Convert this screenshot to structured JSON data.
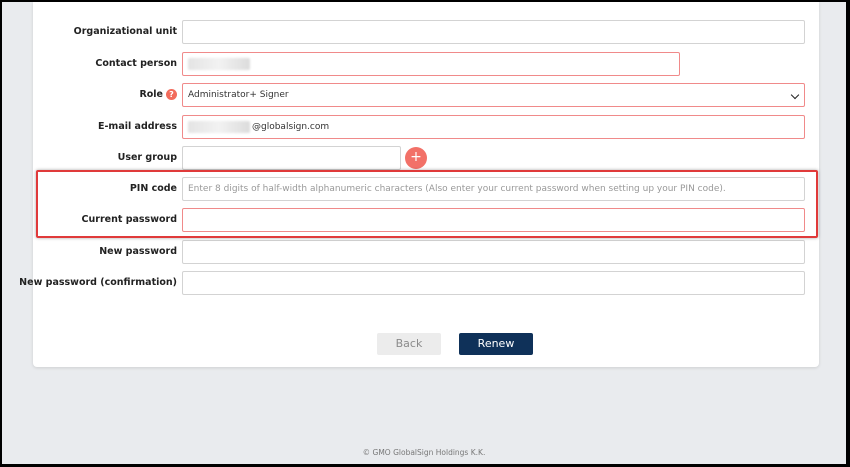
{
  "form": {
    "organizational_unit": {
      "label": "Organizational unit",
      "value": ""
    },
    "contact_person": {
      "label": "Contact person",
      "value": ""
    },
    "role": {
      "label": "Role",
      "help": "?",
      "value": "Administrator+ Signer"
    },
    "email": {
      "label": "E-mail address",
      "value": "@globalsign.com"
    },
    "user_group": {
      "label": "User group",
      "value": "",
      "add_label": "+"
    },
    "pin_code": {
      "label": "PIN code",
      "placeholder": "Enter 8 digits of half-width alphanumeric characters (Also enter your current password when setting up your PIN code)."
    },
    "current_password": {
      "label": "Current password",
      "value": ""
    },
    "new_password": {
      "label": "New password",
      "value": ""
    },
    "new_password_confirm": {
      "label": "New password (confirmation)",
      "value": ""
    }
  },
  "buttons": {
    "back": "Back",
    "renew": "Renew"
  },
  "footer": "© GMO GlobalSign Holdings K.K.",
  "colors": {
    "accent": "#0f3159",
    "required_border": "#f08a8a",
    "highlight": "#e03a3a",
    "add_button": "#f27168"
  },
  "icons": {
    "help": "question-circle-icon",
    "add": "plus-icon",
    "dropdown": "chevron-down-icon"
  }
}
